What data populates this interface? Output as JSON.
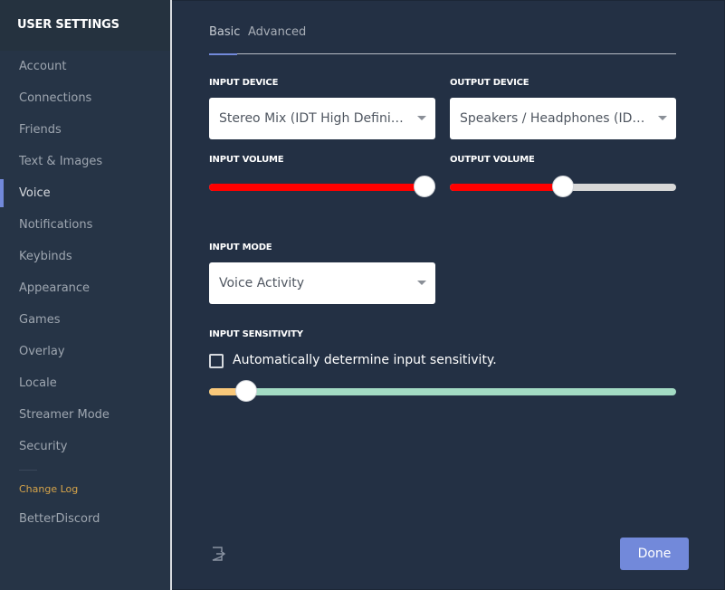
{
  "sidebar": {
    "title": "USER SETTINGS",
    "items": [
      {
        "label": "Account"
      },
      {
        "label": "Connections"
      },
      {
        "label": "Friends"
      },
      {
        "label": "Text & Images"
      },
      {
        "label": "Voice"
      },
      {
        "label": "Notifications"
      },
      {
        "label": "Keybinds"
      },
      {
        "label": "Appearance"
      },
      {
        "label": "Games"
      },
      {
        "label": "Overlay"
      },
      {
        "label": "Locale"
      },
      {
        "label": "Streamer Mode"
      },
      {
        "label": "Security"
      }
    ],
    "active_item": "Voice",
    "changelog_label": "Change Log",
    "betterdiscord_label": "BetterDiscord"
  },
  "tabs": {
    "basic": "Basic",
    "advanced": "Advanced",
    "active": "Basic"
  },
  "input_device": {
    "label": "INPUT DEVICE",
    "value": "Stereo Mix (IDT High Definiti..."
  },
  "output_device": {
    "label": "OUTPUT DEVICE",
    "value": "Speakers / Headphones (IDT ..."
  },
  "input_volume": {
    "label": "INPUT VOLUME",
    "level": 0.95
  },
  "output_volume": {
    "label": "OUTPUT VOLUME",
    "level": 0.5
  },
  "input_mode": {
    "label": "INPUT MODE",
    "value": "Voice Activity"
  },
  "input_sensitivity": {
    "label": "INPUT SENSITIVITY",
    "auto_label": "Automatically determine input sensitivity.",
    "auto_checked": false,
    "level": 0.08
  },
  "footer": {
    "done_label": "Done"
  },
  "colors": {
    "accent": "#7289da",
    "volume_fill": "#ff0000",
    "volume_track": "#d8d8d8",
    "sensitivity_low": "#f9c87a",
    "sensitivity_high": "#a3dbc4",
    "changelog": "#d6a44a"
  },
  "icons": {
    "exit": "exit-icon",
    "caret": "chevron-down-icon"
  }
}
